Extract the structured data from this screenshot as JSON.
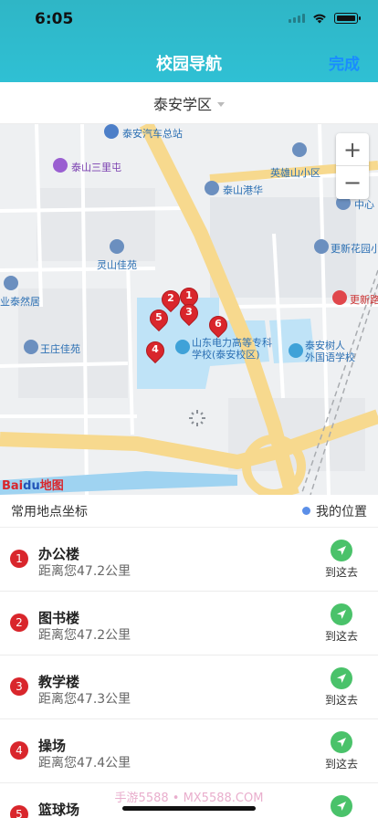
{
  "status": {
    "time": "6:05"
  },
  "nav": {
    "title": "校园导航",
    "done": "完成"
  },
  "campus": {
    "label": "泰安学区"
  },
  "map": {
    "labels": {
      "bus_station": "泰安汽车总站",
      "sanlitun": "泰山三里屯",
      "yingxiong": "英雄山小区",
      "ganghua": "泰山港华",
      "zhongxin": "中心",
      "lingshan": "灵山佳苑",
      "gengxin": "更新花园小",
      "tairan": "业泰然居",
      "gengxin2": "更新路",
      "wangzhuang": "王庄佳苑",
      "college": "山东电力高等专科\n学校(泰安校区)",
      "foreign": "泰安树人\n外国语学校"
    },
    "markers": [
      "1",
      "2",
      "3",
      "4",
      "5",
      "6"
    ],
    "zoom_in": "+",
    "zoom_out": "−",
    "logo": {
      "bai": "Bai",
      "du": "du",
      "ditu": "地图"
    }
  },
  "list": {
    "header": "常用地点坐标",
    "my_position": "我的位置",
    "go_label": "到这去",
    "items": [
      {
        "num": "1",
        "name": "办公楼",
        "distance": "距离您47.2公里"
      },
      {
        "num": "2",
        "name": "图书楼",
        "distance": "距离您47.2公里"
      },
      {
        "num": "3",
        "name": "教学楼",
        "distance": "距离您47.3公里"
      },
      {
        "num": "4",
        "name": "操场",
        "distance": "距离您47.4公里"
      },
      {
        "num": "5",
        "name": "篮球场",
        "distance": ""
      }
    ]
  },
  "watermark": "手游5588 • MX5588.COM",
  "colors": {
    "nav_bg": "#2fbcd0",
    "done": "#1a8cff",
    "marker": "#d9262c",
    "go": "#4ac26a"
  }
}
